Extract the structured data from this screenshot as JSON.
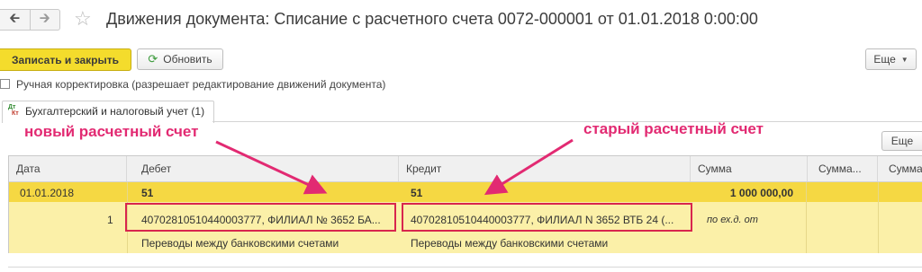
{
  "nav": {
    "back_icon": "arrow-left-icon",
    "forward_icon": "arrow-right-icon"
  },
  "title": "Движения документа: Списание с расчетного счета 0072-000001 от 01.01.2018 0:00:00",
  "toolbar": {
    "save_close_label": "Записать и закрыть",
    "refresh_label": "Обновить",
    "more_label": "Еще"
  },
  "manual_edit": {
    "label": "Ручная корректировка (разрешает редактирование движений документа)",
    "checked": false
  },
  "tab": {
    "icon_top": "Дт",
    "icon_bottom": "Кт",
    "label": "Бухгалтерский и налоговый учет (1)"
  },
  "annotations": {
    "new_account": "новый расчетный счет",
    "old_account": "старый расчетный счет"
  },
  "grid": {
    "more_label": "Еще",
    "columns": [
      "Дата",
      "Дебет",
      "Кредит",
      "Сумма",
      "Сумма...",
      "Сумма..."
    ],
    "rows": [
      {
        "date": "01.01.2018",
        "num": "1",
        "debit_account": "51",
        "debit_subconto": "40702810510440003777, ФИЛИАЛ № 3652 БА...",
        "debit_movement": "Переводы между банковскими счетами",
        "credit_account": "51",
        "credit_subconto": "40702810510440003777, ФИЛИАЛ N 3652 ВТБ 24 (...",
        "credit_movement": "Переводы между банковскими счетами",
        "amount": "1 000 000,00",
        "amount_note": "по ех.д.  от"
      }
    ]
  },
  "colors": {
    "primary_button": "#f4dc2c",
    "selected_row": "#f5d843",
    "row_background": "#fbf0a8",
    "annotation": "#e22a72",
    "highlight_box": "#d8264e"
  }
}
